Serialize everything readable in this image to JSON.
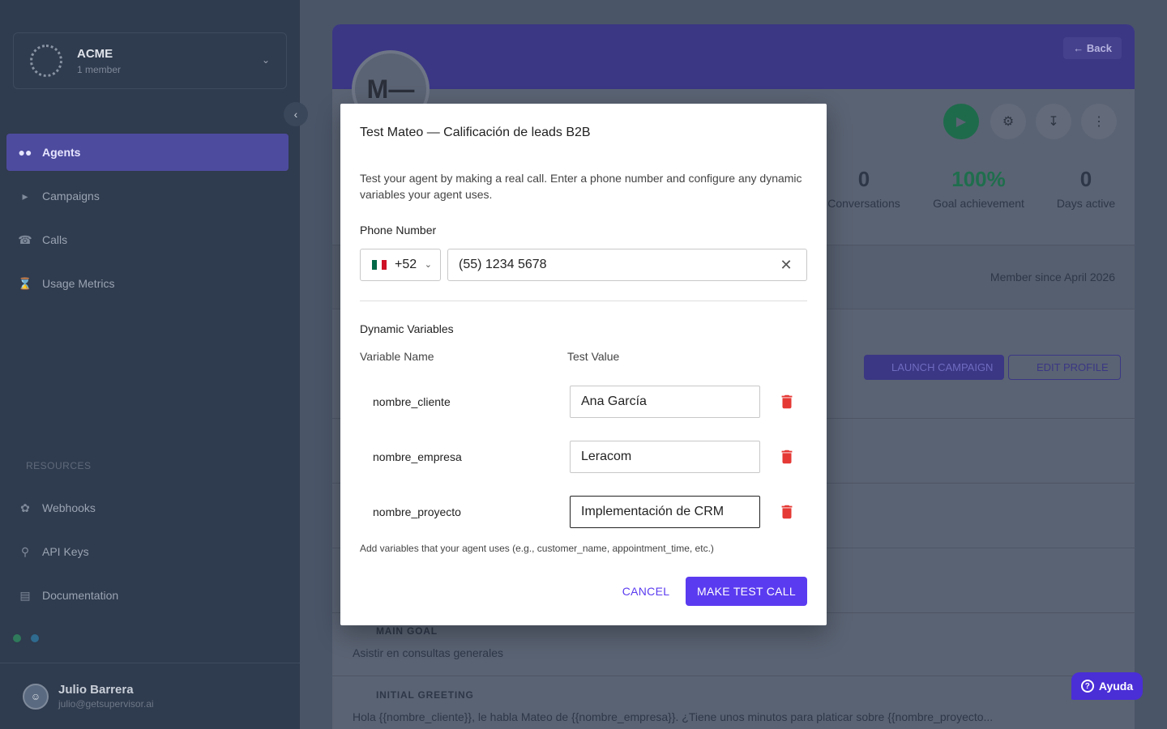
{
  "sidebar": {
    "org_name": "ACME",
    "org_members": "1 member",
    "nav": [
      {
        "label": "Agents",
        "icon": "people-icon",
        "active": true
      },
      {
        "label": "Campaigns",
        "icon": "megaphone-icon"
      },
      {
        "label": "Calls",
        "icon": "phone-icon"
      },
      {
        "label": "Usage Metrics",
        "icon": "hourglass-icon"
      }
    ],
    "resources_title": "RESOURCES",
    "resources": [
      {
        "label": "Webhooks",
        "icon": "webhook-icon"
      },
      {
        "label": "API Keys",
        "icon": "key-icon"
      },
      {
        "label": "Documentation",
        "icon": "document-icon"
      }
    ],
    "user_name": "Julio Barrera",
    "user_email": "julio@getsupervisor.ai"
  },
  "profile": {
    "back_label": "Back",
    "avatar_initials": "M—",
    "stats": [
      {
        "value": "0",
        "label": "Conversations"
      },
      {
        "value": "100%",
        "label": "Goal achievement"
      },
      {
        "value": "0",
        "label": "Days active"
      }
    ],
    "member_since": "Member since April 2026",
    "launch_label": "LAUNCH CAMPAIGN",
    "edit_label": "EDIT PROFILE",
    "main_goal_title": "MAIN GOAL",
    "main_goal_text": "Asistir en consultas generales",
    "greeting_title": "INITIAL GREETING",
    "greeting_text": "Hola {{nombre_cliente}}, le habla Mateo de {{nombre_empresa}}. ¿Tiene unos minutos para platicar sobre {{nombre_proyecto..."
  },
  "help_label": "Ayuda",
  "modal": {
    "title": "Test Mateo — Calificación de leads B2B",
    "description": "Test your agent by making a real call. Enter a phone number and configure any dynamic variables your agent uses.",
    "phone_label": "Phone Number",
    "country_code": "+52",
    "phone_value": "(55) 1234 5678",
    "dynamic_title": "Dynamic Variables",
    "col_name": "Variable Name",
    "col_value": "Test Value",
    "variables": [
      {
        "name": "nombre_cliente",
        "value": "Ana García"
      },
      {
        "name": "nombre_empresa",
        "value": "Leracom"
      },
      {
        "name": "nombre_proyecto",
        "value": "Implementación de CRM"
      }
    ],
    "hint": "Add variables that your agent uses (e.g., customer_name, appointment_time, etc.)",
    "cancel_label": "CANCEL",
    "submit_label": "MAKE TEST CALL"
  },
  "colors": {
    "accent": "#5b3bf0",
    "danger": "#e53935",
    "sidebar_bg": "#2f3b4e"
  }
}
